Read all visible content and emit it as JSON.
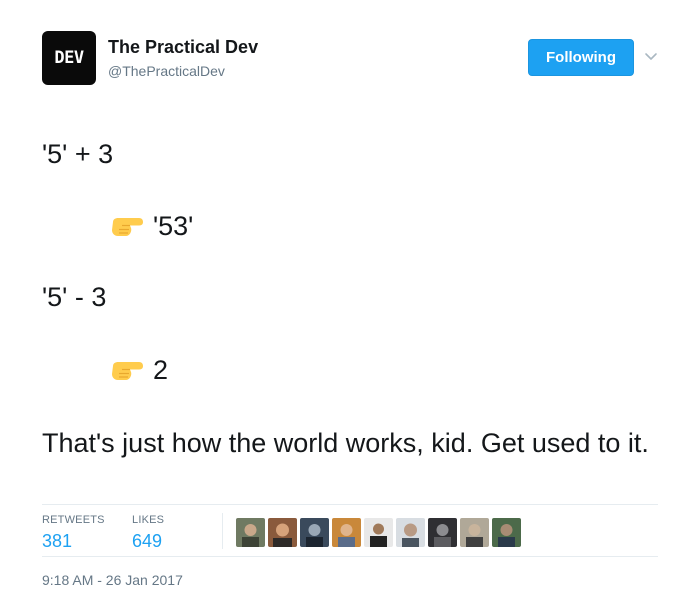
{
  "header": {
    "avatar_text": "DEV",
    "display_name": "The Practical Dev",
    "screen_name": "@ThePracticalDev",
    "follow_button_label": "Following"
  },
  "tweet": {
    "lines": [
      "'5' + 3",
      "'53'",
      "'5' - 3",
      "2",
      "That's just how the world works, kid. Get used to it."
    ],
    "pointer_emoji": "backhand-index-pointing-right"
  },
  "stats": {
    "retweets_label": "RETWEETS",
    "retweets_count": "381",
    "likes_label": "LIKES",
    "likes_count": "649"
  },
  "likers": [
    {
      "name": "liker-avatar-1"
    },
    {
      "name": "liker-avatar-2"
    },
    {
      "name": "liker-avatar-3"
    },
    {
      "name": "liker-avatar-4"
    },
    {
      "name": "liker-avatar-5"
    },
    {
      "name": "liker-avatar-6"
    },
    {
      "name": "liker-avatar-7"
    },
    {
      "name": "liker-avatar-8"
    },
    {
      "name": "liker-avatar-9"
    }
  ],
  "timestamp": "9:18 AM - 26 Jan 2017",
  "colors": {
    "accent": "#1da1f2",
    "text": "#14171a",
    "muted": "#657786",
    "divider": "#e6ecf0",
    "emoji": "#ffcc4d"
  }
}
